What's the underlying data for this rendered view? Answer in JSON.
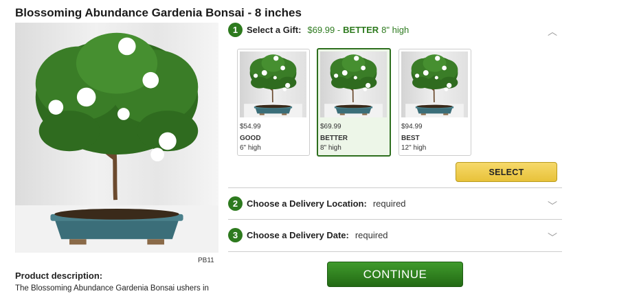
{
  "product": {
    "title": "Blossoming Abundance Gardenia Bonsai - 8 inches",
    "sku": "PB11",
    "description_heading": "Product description:",
    "description_text": "The Blossoming Abundance Gardenia Bonsai ushers in"
  },
  "step1": {
    "number": "1",
    "label": "Select a Gift:",
    "price": "$69.99 -",
    "tier": "BETTER",
    "size": "8\" high"
  },
  "options": [
    {
      "price": "$54.99",
      "tier": "GOOD",
      "size": "6\" high",
      "selected": false
    },
    {
      "price": "$69.99",
      "tier": "BETTER",
      "size": "8\" high",
      "selected": true
    },
    {
      "price": "$94.99",
      "tier": "BEST",
      "size": "12\" high",
      "selected": false
    }
  ],
  "select_button": "SELECT",
  "step2": {
    "number": "2",
    "label": "Choose a Delivery Location:",
    "value": "required"
  },
  "step3": {
    "number": "3",
    "label": "Choose a Delivery Date:",
    "value": "required"
  },
  "continue_button": "CONTINUE",
  "icons": {
    "collapse": "chevron-up-icon",
    "expand": "chevron-down-icon"
  },
  "colors": {
    "accent_green": "#2d7a1e",
    "select_gold": "#e8c23a",
    "selected_bg": "#edf6e8"
  }
}
